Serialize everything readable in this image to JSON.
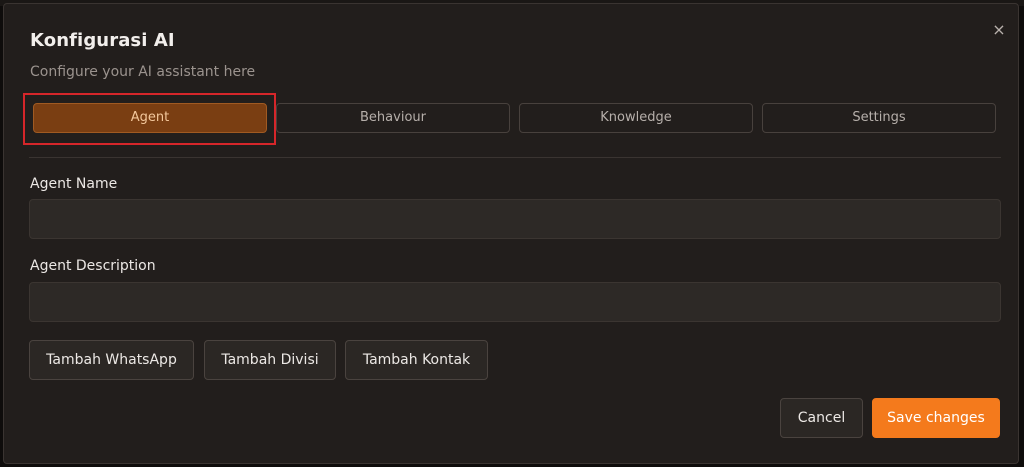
{
  "dialog": {
    "title": "Konfigurasi AI",
    "subtitle": "Configure your AI assistant here",
    "close_icon": "×"
  },
  "tabs": [
    {
      "label": "Agent",
      "active": true
    },
    {
      "label": "Behaviour",
      "active": false
    },
    {
      "label": "Knowledge",
      "active": false
    },
    {
      "label": "Settings",
      "active": false
    }
  ],
  "fields": {
    "agent_name": {
      "label": "Agent Name",
      "value": "",
      "placeholder": ""
    },
    "agent_description": {
      "label": "Agent Description",
      "value": "",
      "placeholder": ""
    }
  },
  "actions": [
    {
      "label": "Tambah WhatsApp"
    },
    {
      "label": "Tambah Divisi"
    },
    {
      "label": "Tambah Kontak"
    }
  ],
  "footer": {
    "cancel_label": "Cancel",
    "save_label": "Save changes"
  },
  "colors": {
    "accent": "#f47a1c",
    "active_tab": "#7a3e12",
    "highlight": "#d6262a",
    "dialog_bg": "#221e1c"
  }
}
